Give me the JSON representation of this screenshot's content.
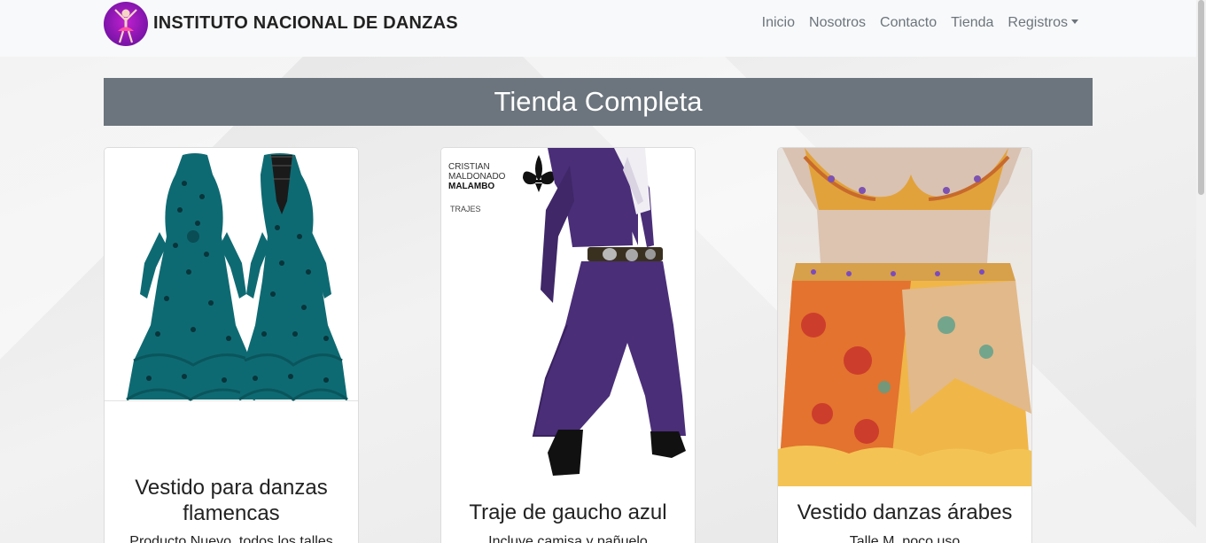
{
  "brand": {
    "name": "INSTITUTO NACIONAL DE DANZAS",
    "logo_icon": "dancer-logo-icon"
  },
  "nav": {
    "items": [
      "Inicio",
      "Nosotros",
      "Contacto",
      "Tienda"
    ],
    "dropdown_label": "Registros"
  },
  "page": {
    "heading": "Tienda Completa"
  },
  "products": [
    {
      "title": "Vestido para danzas flamencas",
      "description": "Producto Nuevo, todos los talles"
    },
    {
      "title": "Traje de gaucho azul",
      "description": "Incluye camisa y pañuelo",
      "image_caption": {
        "line1": "CRISTIAN",
        "line2": "MALDONADO",
        "line3": "MALAMBO",
        "line4": "TRAJES"
      }
    },
    {
      "title": "Vestido danzas árabes",
      "description": "Talle M, poco uso"
    }
  ],
  "colors": {
    "header_bar": "#6c757d",
    "nav_text": "#6c757d",
    "dress_teal": "#0e6a72",
    "suit_purple": "#4a2e78"
  }
}
